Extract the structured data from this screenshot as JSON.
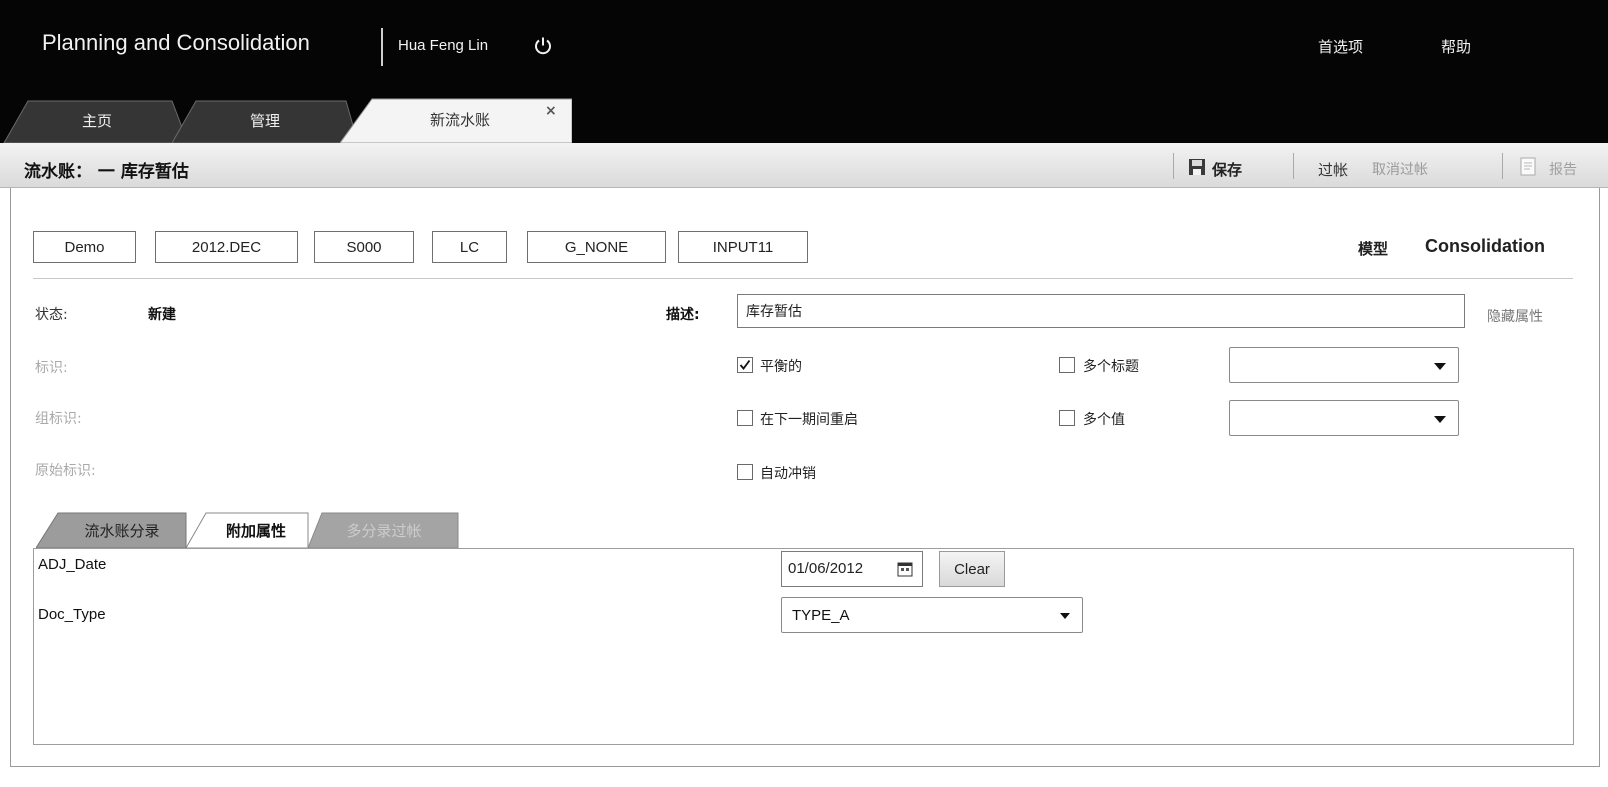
{
  "header": {
    "app_title": "Planning and Consolidation",
    "user": "Hua Feng Lin",
    "preferences": "首选项",
    "help": "帮助"
  },
  "tabs": [
    {
      "label": "主页",
      "active": false
    },
    {
      "label": "管理",
      "active": false
    },
    {
      "label": "新流水账",
      "active": true,
      "close": "×"
    }
  ],
  "toolbar": {
    "page_title": "流水账： 一 库存暂估",
    "save": "保存",
    "post": "过帐",
    "unpost": "取消过帐",
    "report": "报告"
  },
  "dimensions": [
    "Demo",
    "2012.DEC",
    "S000",
    "LC",
    "G_NONE",
    "INPUT11"
  ],
  "model": {
    "label": "模型",
    "value": "Consolidation"
  },
  "form": {
    "status_label": "状态:",
    "status_value": "新建",
    "id_label": "标识:",
    "group_id_label": "组标识:",
    "original_id_label": "原始标识:",
    "desc_label": "描述:",
    "desc_value": "库存暂估",
    "hide_attrs": "隐藏属性",
    "balanced": {
      "label": "平衡的",
      "checked": true
    },
    "reopen_next": {
      "label": "在下一期间重启",
      "checked": false
    },
    "auto_reverse": {
      "label": "自动冲销",
      "checked": false
    },
    "multi_header": {
      "label": "多个标题",
      "checked": false
    },
    "multi_value": {
      "label": "多个值",
      "checked": false
    }
  },
  "subtabs": [
    {
      "label": "流水账分录",
      "state": "inactive"
    },
    {
      "label": "附加属性",
      "state": "active"
    },
    {
      "label": "多分录过帐",
      "state": "disabled"
    }
  ],
  "attributes": {
    "adj_date_label": "ADJ_Date",
    "adj_date_value": "01/06/2012",
    "clear": "Clear",
    "doc_type_label": "Doc_Type",
    "doc_type_value": "TYPE_A"
  }
}
